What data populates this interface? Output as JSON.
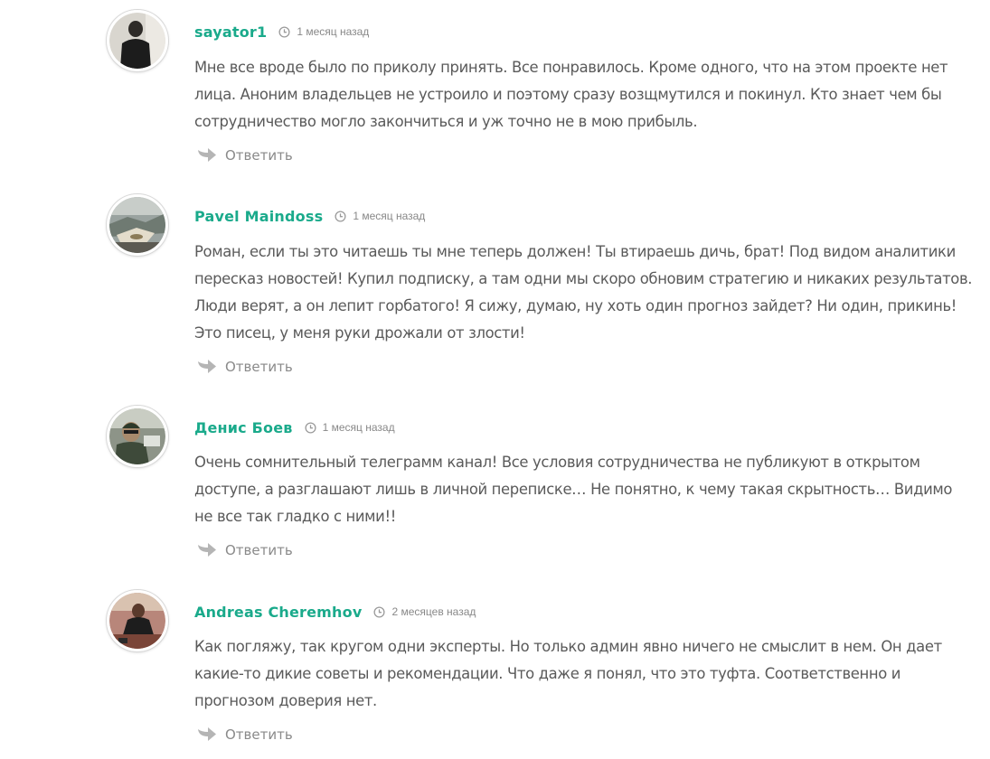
{
  "comments": [
    {
      "author": "sayator1",
      "time": "1 месяц назад",
      "lines": [
        "Мне все вроде было по приколу принять. Все понравилось. Кроме одного, что на этом проекте нет",
        "лица. Аноним владельцев не устроило и поэтому сразу возщмутился и покинул. Кто знает чем бы",
        "сотрудничество могло закончиться и уж точно не в мою прибыль."
      ],
      "reply_label": "Ответить",
      "avatar_icon": "user-photo"
    },
    {
      "author": "Pavel Maindoss",
      "time": "1 месяц назад",
      "lines": [
        "Роман, если ты это читаешь ты мне теперь должен! Ты втираешь дичь, брат! Под видом аналитики",
        "пересказ новостей! Купил подписку, а там одни мы скоро обновим стратегию и никаких результатов.",
        "Люди верят, а он лепит горбатого! Я сижу, думаю, ну хоть один прогноз зайдет? Ни один, прикинь!",
        "Это писец, у меня руки дрожали от злости!"
      ],
      "reply_label": "Ответить",
      "avatar_icon": "user-photo"
    },
    {
      "author": "Денис Боев",
      "time": "1 месяц назад",
      "lines": [
        "Очень сомнительный телеграмм канал! Все условия сотрудничества не публикуют в открытом",
        "доступе, а разглашают лишь в личной переписке… Не понятно, к чему такая скрытность… Видимо",
        "не все так гладко с ними!!"
      ],
      "reply_label": "Ответить",
      "avatar_icon": "user-photo"
    },
    {
      "author": "Andreas Cheremhov",
      "time": "2 месяцев назад",
      "lines": [
        "Как погляжу, так кругом одни эксперты. Но только админ явно ничего не смыслит в нем. Он дает",
        "какие-то дикие советы и рекомендации. Что даже я понял, что это туфта. Соответственно и",
        "прогнозом доверия нет."
      ],
      "reply_label": "Ответить",
      "avatar_icon": "user-photo"
    }
  ],
  "colors": {
    "author": "#1aaa8b",
    "text": "#5a5a5a",
    "meta": "#888888",
    "reply": "#8a8a8a",
    "icon": "#b5b5b5"
  }
}
